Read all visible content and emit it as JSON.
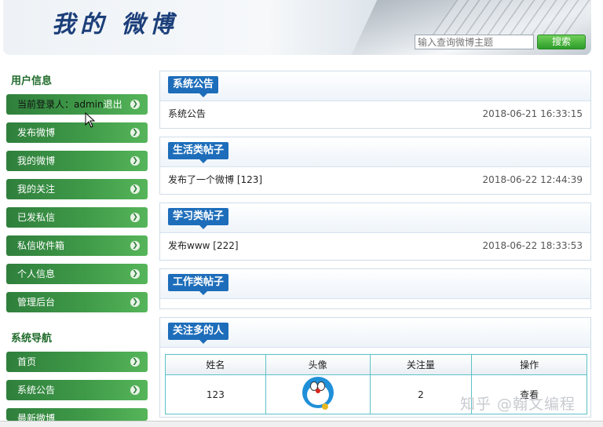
{
  "header": {
    "site_title": "我的 微博",
    "search_placeholder": "输入查询微博主题",
    "search_button": "搜索"
  },
  "sidebar": {
    "user_section_title": "用户信息",
    "current_user_label": "当前登录人：",
    "current_user_name": "admin",
    "logout_label": "退出",
    "user_menu": [
      {
        "label": "发布微博"
      },
      {
        "label": "我的微博"
      },
      {
        "label": "我的关注"
      },
      {
        "label": "已发私信"
      },
      {
        "label": "私信收件箱"
      },
      {
        "label": "个人信息"
      },
      {
        "label": "管理后台"
      }
    ],
    "nav_section_title": "系统导航",
    "nav_menu": [
      {
        "label": "首页"
      },
      {
        "label": "系统公告"
      },
      {
        "label": "最新微博"
      }
    ],
    "arrow_icon": "chevron-right-icon"
  },
  "panels": {
    "announcement": {
      "title": "系统公告",
      "rows": [
        {
          "text": "系统公告",
          "date": "2018-06-21 16:33:15"
        }
      ]
    },
    "life": {
      "title": "生活类帖子",
      "rows": [
        {
          "text": "发布了一个微博 [123]",
          "date": "2018-06-22 12:44:39"
        }
      ]
    },
    "study": {
      "title": "学习类帖子",
      "rows": [
        {
          "text": "发布www [222]",
          "date": "2018-06-22 18:33:53"
        }
      ]
    },
    "work": {
      "title": "工作类帖子",
      "rows": []
    },
    "popular": {
      "title": "关注多的人",
      "columns": [
        "姓名",
        "头像",
        "关注量",
        "操作"
      ],
      "rows": [
        {
          "name": "123",
          "avatar_icon": "doraemon-avatar",
          "follows": "2",
          "action": "查看"
        }
      ]
    }
  },
  "watermark": "知乎 @翰文编程",
  "colors": {
    "menu_green": "#3f9a48",
    "tag_blue": "#1d6dba",
    "title_blue": "#1c3f7a",
    "table_border": "#5cc2c8"
  }
}
